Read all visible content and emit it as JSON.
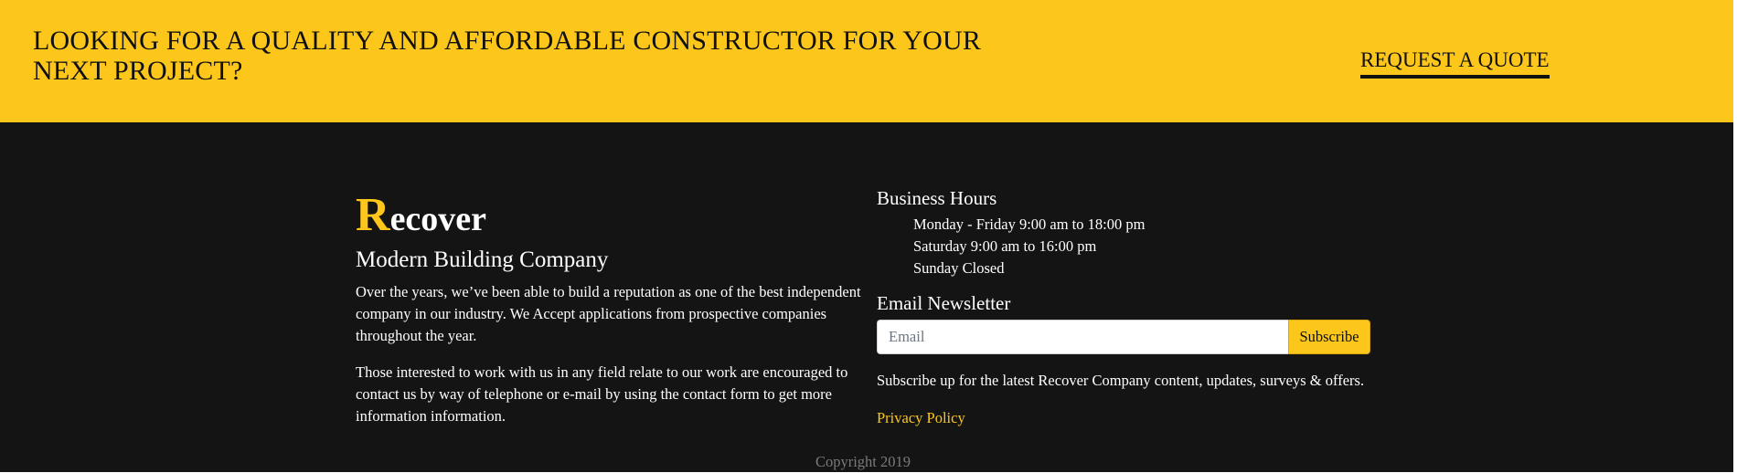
{
  "cta": {
    "heading": "LOOKING FOR A QUALITY AND AFFORDABLE CONSTRUCTOR FOR YOUR NEXT PROJECT?",
    "button_label": "REQUEST A QUOTE"
  },
  "brand": {
    "initial": "R",
    "rest": "ecover",
    "tagline": "Modern Building Company"
  },
  "about": {
    "paragraphs": [
      "Over the years, we’ve been able to build a reputation as one of the best independent company in our industry. We Accept applications from prospective companies throughout the year.",
      "Those interested to work with us in any field relate to our work are encouraged to contact us by way of telephone or e-mail by using the contact form to get more information information."
    ]
  },
  "hours": {
    "title": "Business Hours",
    "items": [
      "Monday - Friday 9:00 am to 18:00 pm",
      "Saturday 9:00 am to 16:00 pm",
      "Sunday Closed"
    ]
  },
  "newsletter": {
    "title": "Email Newsletter",
    "email_placeholder": "Email",
    "email_value": "",
    "subscribe_label": "Subscribe",
    "note": "Subscribe up for the latest Recover Company content, updates, surveys & offers.",
    "privacy_label": "Privacy Policy"
  },
  "footer": {
    "copyright": "Copyright 2019"
  },
  "colors": {
    "accent": "#fcc71a",
    "footer_bg": "#141414",
    "text_dark": "#111111",
    "text_light": "#ffffff",
    "muted": "#7a7a7a"
  }
}
